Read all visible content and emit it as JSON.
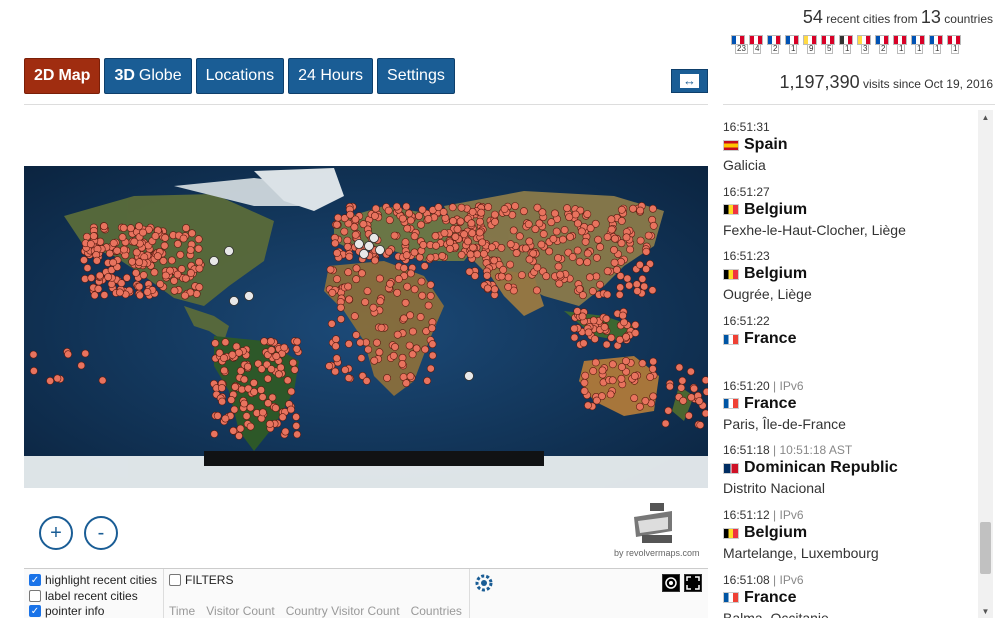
{
  "tabs": [
    {
      "prefix": "2D",
      "label": "Map",
      "active": true
    },
    {
      "prefix": "3D",
      "label": "Globe",
      "active": false
    },
    {
      "prefix": "",
      "label": "Locations",
      "active": false
    },
    {
      "prefix": "",
      "label": "24 Hours",
      "active": false
    },
    {
      "prefix": "",
      "label": "Settings",
      "active": false
    }
  ],
  "expand_icon": "↔",
  "stats": {
    "cities_count": "54",
    "cities_label": "recent cities from",
    "countries_count": "13",
    "countries_label": "countries",
    "visits_count": "1,197,390",
    "visits_label": "visits since Oct 19, 2016"
  },
  "flag_counts": [
    {
      "n": "23",
      "color": "#0052b4"
    },
    {
      "n": "4",
      "color": "#d80027"
    },
    {
      "n": "2",
      "color": "#0052b4"
    },
    {
      "n": "1",
      "color": "#0052b4"
    },
    {
      "n": "9",
      "color": "#ffda44"
    },
    {
      "n": "5",
      "color": "#d80027"
    },
    {
      "n": "1",
      "color": "#333333"
    },
    {
      "n": "3",
      "color": "#ffda44"
    },
    {
      "n": "2",
      "color": "#0052b4"
    },
    {
      "n": "1",
      "color": "#d80027"
    },
    {
      "n": "1",
      "color": "#0052b4"
    },
    {
      "n": "1",
      "color": "#0052b4"
    },
    {
      "n": "1",
      "color": "#d80027"
    }
  ],
  "map": {
    "zoom_in": "+",
    "zoom_out": "-",
    "credit": "by revolvermaps.com"
  },
  "options": {
    "highlight": "highlight recent cities",
    "label": "label recent cities",
    "pointer": "pointer info",
    "filters": "FILTERS",
    "columns": [
      "Time",
      "Visitor Count",
      "Country Visitor Count",
      "Countries"
    ]
  },
  "feed": [
    {
      "time": "16:51:31",
      "extra": "",
      "country": "Spain",
      "region": "Galicia",
      "flag": [
        "#c60b1e",
        "#ffc400",
        "#c60b1e"
      ]
    },
    {
      "time": "16:51:27",
      "extra": "",
      "country": "Belgium",
      "region": "Fexhe-le-Haut-Clocher, Liège",
      "flag": [
        "#000000",
        "#fdda24",
        "#ef3340"
      ]
    },
    {
      "time": "16:51:23",
      "extra": "",
      "country": "Belgium",
      "region": "Ougrée, Liège",
      "flag": [
        "#000000",
        "#fdda24",
        "#ef3340"
      ]
    },
    {
      "time": "16:51:22",
      "extra": "",
      "country": "France",
      "region": "",
      "flag": [
        "#0055a4",
        "#ffffff",
        "#ef4135"
      ]
    },
    {
      "time": "16:51:20",
      "extra": " | IPv6",
      "country": "France",
      "region": "Paris, Île-de-France",
      "flag": [
        "#0055a4",
        "#ffffff",
        "#ef4135"
      ]
    },
    {
      "time": "16:51:18",
      "extra": " | 10:51:18 AST",
      "country": "Dominican Republic",
      "region": "Distrito Nacional",
      "flag": [
        "#002d62",
        "#ffffff",
        "#ce1126"
      ]
    },
    {
      "time": "16:51:12",
      "extra": " | IPv6",
      "country": "Belgium",
      "region": "Martelange, Luxembourg",
      "flag": [
        "#000000",
        "#fdda24",
        "#ef3340"
      ]
    },
    {
      "time": "16:51:08",
      "extra": " | IPv6",
      "country": "France",
      "region": "Balma, Occitanie",
      "flag": [
        "#0055a4",
        "#ffffff",
        "#ef4135"
      ]
    }
  ],
  "colors": {
    "tab_active": "#a02d10",
    "tab": "#1a5d95",
    "dot": "#e8735e",
    "dot_recent": "#e8e8e8"
  }
}
